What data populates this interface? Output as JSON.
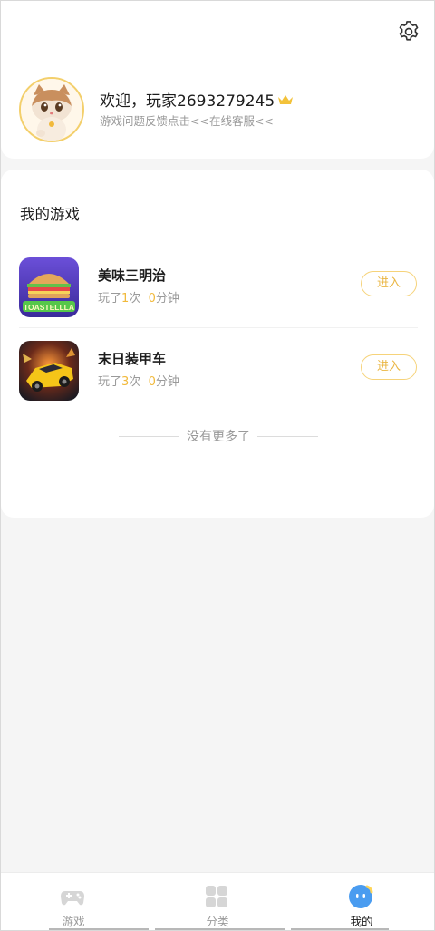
{
  "profile": {
    "welcome_text": "欢迎，玩家2693279245",
    "feedback_text": "游戏问题反馈点击<<在线客服<<",
    "icons": {
      "settings": "gear-icon",
      "crown": "crown-icon",
      "avatar": "cat-avatar"
    }
  },
  "my_games": {
    "title": "我的游戏",
    "items": [
      {
        "name": "美味三明治",
        "played_prefix": "玩了",
        "play_count": "1",
        "count_unit": "次",
        "minutes": "0",
        "minutes_unit": "分钟",
        "enter_label": "进入",
        "icon_text": "TOASTELLLA"
      },
      {
        "name": "末日装甲车",
        "played_prefix": "玩了",
        "play_count": "3",
        "count_unit": "次",
        "minutes": "0",
        "minutes_unit": "分钟",
        "enter_label": "进入"
      }
    ],
    "end_text": "没有更多了"
  },
  "tabbar": {
    "tabs": [
      {
        "label": "游戏",
        "icon": "gamepad-icon",
        "active": false
      },
      {
        "label": "分类",
        "icon": "grid-icon",
        "active": false
      },
      {
        "label": "我的",
        "icon": "profile-face-icon",
        "active": true
      }
    ]
  },
  "colors": {
    "accent": "#f1b93b",
    "enter_border": "#f6d37a",
    "active_tab_blue": "#4a9cf0",
    "background": "#f5f5f5"
  }
}
